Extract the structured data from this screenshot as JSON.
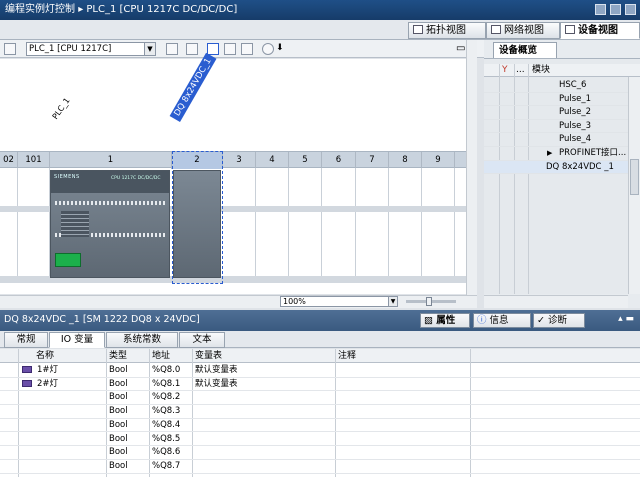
{
  "titlebar": {
    "project": "编程实例灯控制",
    "sep": "▸",
    "path": "PLC_1 [CPU 1217C DC/DC/DC]"
  },
  "viewtabs": [
    {
      "label": "拓扑视图"
    },
    {
      "label": "网络视图"
    },
    {
      "label": "设备视图"
    }
  ],
  "toolbar": {
    "device_select": "PLC_1 [CPU 1217C]"
  },
  "canvas": {
    "plc_label": "PLC_1",
    "dq_label": "DQ 8x24VDC_1",
    "cpu_brand": "SIEMENS",
    "cpu_model": "CPU 1217C DC/DC/DC",
    "slots": [
      "02",
      "101",
      "1",
      "2",
      "3",
      "4",
      "5",
      "6",
      "7",
      "8",
      "9"
    ]
  },
  "zoom": "100%",
  "overview": {
    "tab": "设备概览",
    "header_module": "模块",
    "header_dots": "...",
    "rows": [
      "HSC_6",
      "Pulse_1",
      "Pulse_2",
      "Pulse_3",
      "Pulse_4",
      "PROFINET接口...",
      "DQ 8x24VDC _1"
    ]
  },
  "inspector": {
    "title": "DQ 8x24VDC _1 [SM 1222 DQ8 x 24VDC]",
    "tabs": [
      "属性",
      "信息",
      "诊断"
    ],
    "subtabs": [
      "常规",
      "IO 变量",
      "系统常数",
      "文本"
    ]
  },
  "io": {
    "headers": [
      "名称",
      "类型",
      "地址",
      "变量表",
      "注释"
    ],
    "rows": [
      {
        "name": "1#灯",
        "type": "Bool",
        "addr": "%Q8.0",
        "table": "默认变量表"
      },
      {
        "name": "2#灯",
        "type": "Bool",
        "addr": "%Q8.1",
        "table": "默认变量表"
      },
      {
        "name": "",
        "type": "Bool",
        "addr": "%Q8.2",
        "table": ""
      },
      {
        "name": "",
        "type": "Bool",
        "addr": "%Q8.3",
        "table": ""
      },
      {
        "name": "",
        "type": "Bool",
        "addr": "%Q8.4",
        "table": ""
      },
      {
        "name": "",
        "type": "Bool",
        "addr": "%Q8.5",
        "table": ""
      },
      {
        "name": "",
        "type": "Bool",
        "addr": "%Q8.6",
        "table": ""
      },
      {
        "name": "",
        "type": "Bool",
        "addr": "%Q8.7",
        "table": ""
      }
    ]
  }
}
